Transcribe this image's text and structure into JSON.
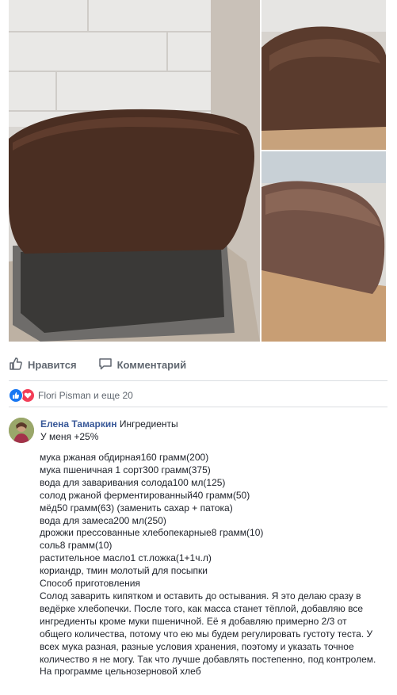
{
  "post": {
    "actions": {
      "like_label": "Нравится",
      "comment_label": "Комментарий"
    },
    "reactions": {
      "summary": "Flori Pisman и еще 20"
    }
  },
  "comment": {
    "author": "Елена Тамаркин",
    "head_text": "Ингредиенты",
    "sub_line": "У меня +25%",
    "lines": [
      "мука ржаная обдирная160 грамм(200)",
      "мука пшеничная 1 сорт300 грамм(375)",
      "вода для заваривания солода100 мл(125)",
      "солод ржаной ферментированный40 грамм(50)",
      "мёд50 грамм(63) (заменить сахар + патока)",
      "вода для замеса200 мл(250)",
      "дрожжи прессованные хлебопекарные8 грамм(10)",
      "соль8 грамм(10)",
      "растительное масло1 ст.ложка(1+1ч.л)",
      "кориандр, тмин молотый для посыпки",
      "Способ приготовления"
    ],
    "paragraph": "Солод заварить кипятком и оставить до остывания. Я это делаю сразу в ведёрке хлебопечки. После того, как масса станет тёплой, добавляю все ингредиенты кроме муки пшеничной. Её я добавляю примерно 2/3 от общего количества, потому что ею мы будем регулировать густоту теста. У всех мука разная, разные условия хранения, поэтому и указать точное количество я не могу. Так что лучше добавлять постепенно, под контролем.",
    "last_line": "На программе цельнозерновой хлеб"
  },
  "icons": {
    "like": "thumbs-up-icon",
    "comment": "speech-bubble-icon",
    "like_reaction": "like-reaction-icon",
    "love_reaction": "heart-reaction-icon"
  },
  "colors": {
    "link": "#385898",
    "like_blue": "#1877f2",
    "love_red": "#f33e58",
    "muted": "#606770"
  }
}
